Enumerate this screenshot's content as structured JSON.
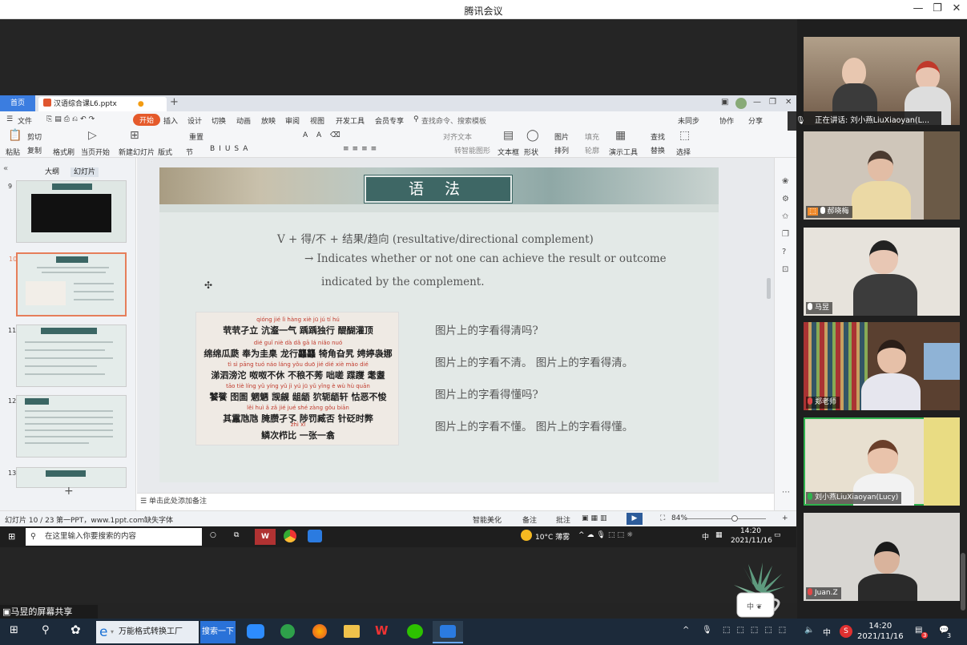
{
  "window": {
    "title": "腾讯会议"
  },
  "wps": {
    "home_tab": "首页",
    "doc_tab": "汉语综合课L6.pptx",
    "menu": [
      "文件",
      "开始",
      "插入",
      "设计",
      "切换",
      "动画",
      "放映",
      "审阅",
      "视图",
      "开发工具",
      "会员专享"
    ],
    "search_cmd": "查找命令、搜索模板",
    "sync": [
      "未同步",
      "协作",
      "分享"
    ],
    "ribbon": {
      "paste": "粘贴",
      "cut": "剪切",
      "copy": "复制",
      "format_painter": "格式刷",
      "from_current": "当页开始",
      "new_slide": "新建幻灯片",
      "layout": "版式",
      "section": "节",
      "reset": "重置",
      "align_text": "对齐文本",
      "smart_graphic": "转智能图形",
      "textbox": "文本框",
      "shape": "形状",
      "picture": "图片",
      "fill": "填充",
      "arrange": "排列",
      "outline": "轮廓",
      "presenter_tools": "演示工具",
      "find": "查找",
      "replace": "替换",
      "select": "选择"
    },
    "panel_tabs": [
      "大纲",
      "幻灯片"
    ],
    "thumb_numbers": [
      "9",
      "10",
      "11",
      "12",
      "13"
    ],
    "slide": {
      "title": "语 法",
      "rule_line1": "V + 得/不 + 结果/趋向 (resultative/directional complement)",
      "rule_line2": "→ Indicates whether or not one can achieve the result or outcome",
      "rule_line3": "indicated by the complement.",
      "questions": [
        "图片上的字看得清吗?",
        "图片上的字看不清。  图片上的字看得清。",
        "图片上的字看得懂吗?",
        "图片上的字看不懂。  图片上的字看得懂。"
      ],
      "idioms": [
        {
          "py": "qióng jié   lì  hàng xiè            jū  jú           tí  hú",
          "text": "茕茕孑立 沆瀣一气 踽踽独行 醍醐灌顶"
        },
        {
          "py": "dié          guǐ niè        dà dǎ       gā  lá      niǎo nuó",
          "text": "绵绵瓜瓞 奉为圭臬 龙行龘龘 犄角旮旯 娉婷袅娜"
        },
        {
          "py": "tì sì pāng tuó    náo        láng   yǒu duō jié   dié xiè mào dié",
          "text": "涕泗滂沱 呶呶不休 不稂不莠 咄嗟 蹀躞 耄耋"
        },
        {
          "py": "tāo tiè  líng yǔ yíng yǔ  jì  yú   jū  yǔ  yǐng  è  wù     hù    quān",
          "text": "饕餮 囹圄 魍魉 觊觎 龃龉 狖轭龉轩 怙恶不悛"
        },
        {
          "py": "lěi       huì   ǎ   zǎ  jié jué  shé    zàng gǒu    biān",
          "text": "其靁虺虺 腌臜孑孓 陟罚臧否 针砭时弊"
        },
        {
          "py": "zhì             xī",
          "text": "鳞次栉比 一张一翕"
        }
      ]
    },
    "notes": "单击此处添加备注",
    "status": {
      "slide_count": "幻灯片 10 / 23",
      "theme": "第一PPT，www.1ppt.com",
      "missing_font": "缺失字体",
      "smart_beautify": "智能美化",
      "notes_btn": "备注",
      "comments_btn": "批注",
      "zoom": "84%"
    }
  },
  "shared_taskbar": {
    "search_placeholder": "在这里输入你要搜索的内容",
    "weather": "10°C 薄雾",
    "ime": "中",
    "time": "14:20",
    "date": "2021/11/16"
  },
  "share_label": "马昱的屏幕共享",
  "speaker_bar": "正在讲话: 刘小燕LiuXiaoyan(L...",
  "participants": [
    {
      "name": "",
      "muted": false
    },
    {
      "name": "郝晓梅",
      "muted": false
    },
    {
      "name": "马昱",
      "muted": false
    },
    {
      "name": "郑老师",
      "muted": true
    },
    {
      "name": "刘小燕LiuXiaoyan(Lucy)",
      "muted": false
    },
    {
      "name": "Juan.Z",
      "muted": true
    }
  ],
  "taskbar": {
    "ie_app": "万能格式转换工厂",
    "search_btn": "搜索一下",
    "ime": "中",
    "time": "14:20",
    "date": "2021/11/16",
    "notif_count": "3"
  },
  "colors": {
    "accent": "#3b7de0",
    "slide_title_bg": "#3e6765",
    "wps_start": "#e55a2b"
  }
}
